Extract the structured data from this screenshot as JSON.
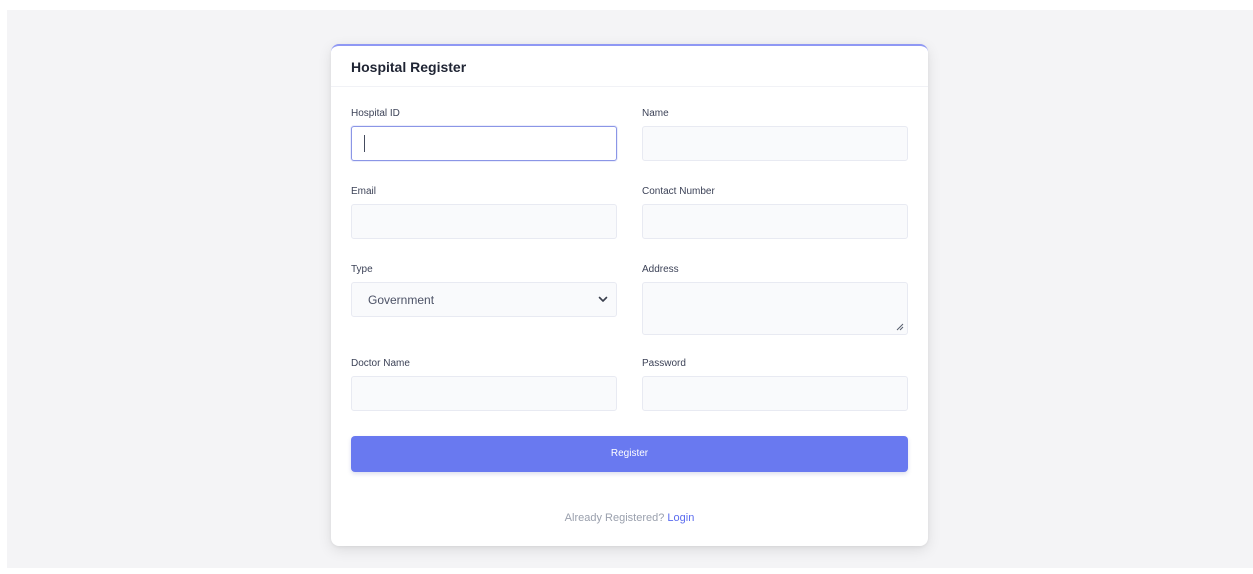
{
  "card": {
    "title": "Hospital Register"
  },
  "fields": {
    "hospital_id": {
      "label": "Hospital ID",
      "value": ""
    },
    "name": {
      "label": "Name",
      "value": ""
    },
    "email": {
      "label": "Email",
      "value": ""
    },
    "contact_number": {
      "label": "Contact Number",
      "value": ""
    },
    "type": {
      "label": "Type",
      "selected": "Government"
    },
    "address": {
      "label": "Address",
      "value": ""
    },
    "doctor_name": {
      "label": "Doctor Name",
      "value": ""
    },
    "password": {
      "label": "Password",
      "value": ""
    }
  },
  "actions": {
    "register_label": "Register"
  },
  "footer": {
    "prompt": "Already Registered?",
    "login_label": "Login"
  },
  "icons": {
    "type_dropdown": "chevron-down-icon",
    "address_resize": "resize-grip-icon"
  },
  "colors": {
    "accent": "#6979f0",
    "link": "#5b6cef",
    "card_top_border": "#8f98f4",
    "page_background": "#f4f4f6"
  }
}
